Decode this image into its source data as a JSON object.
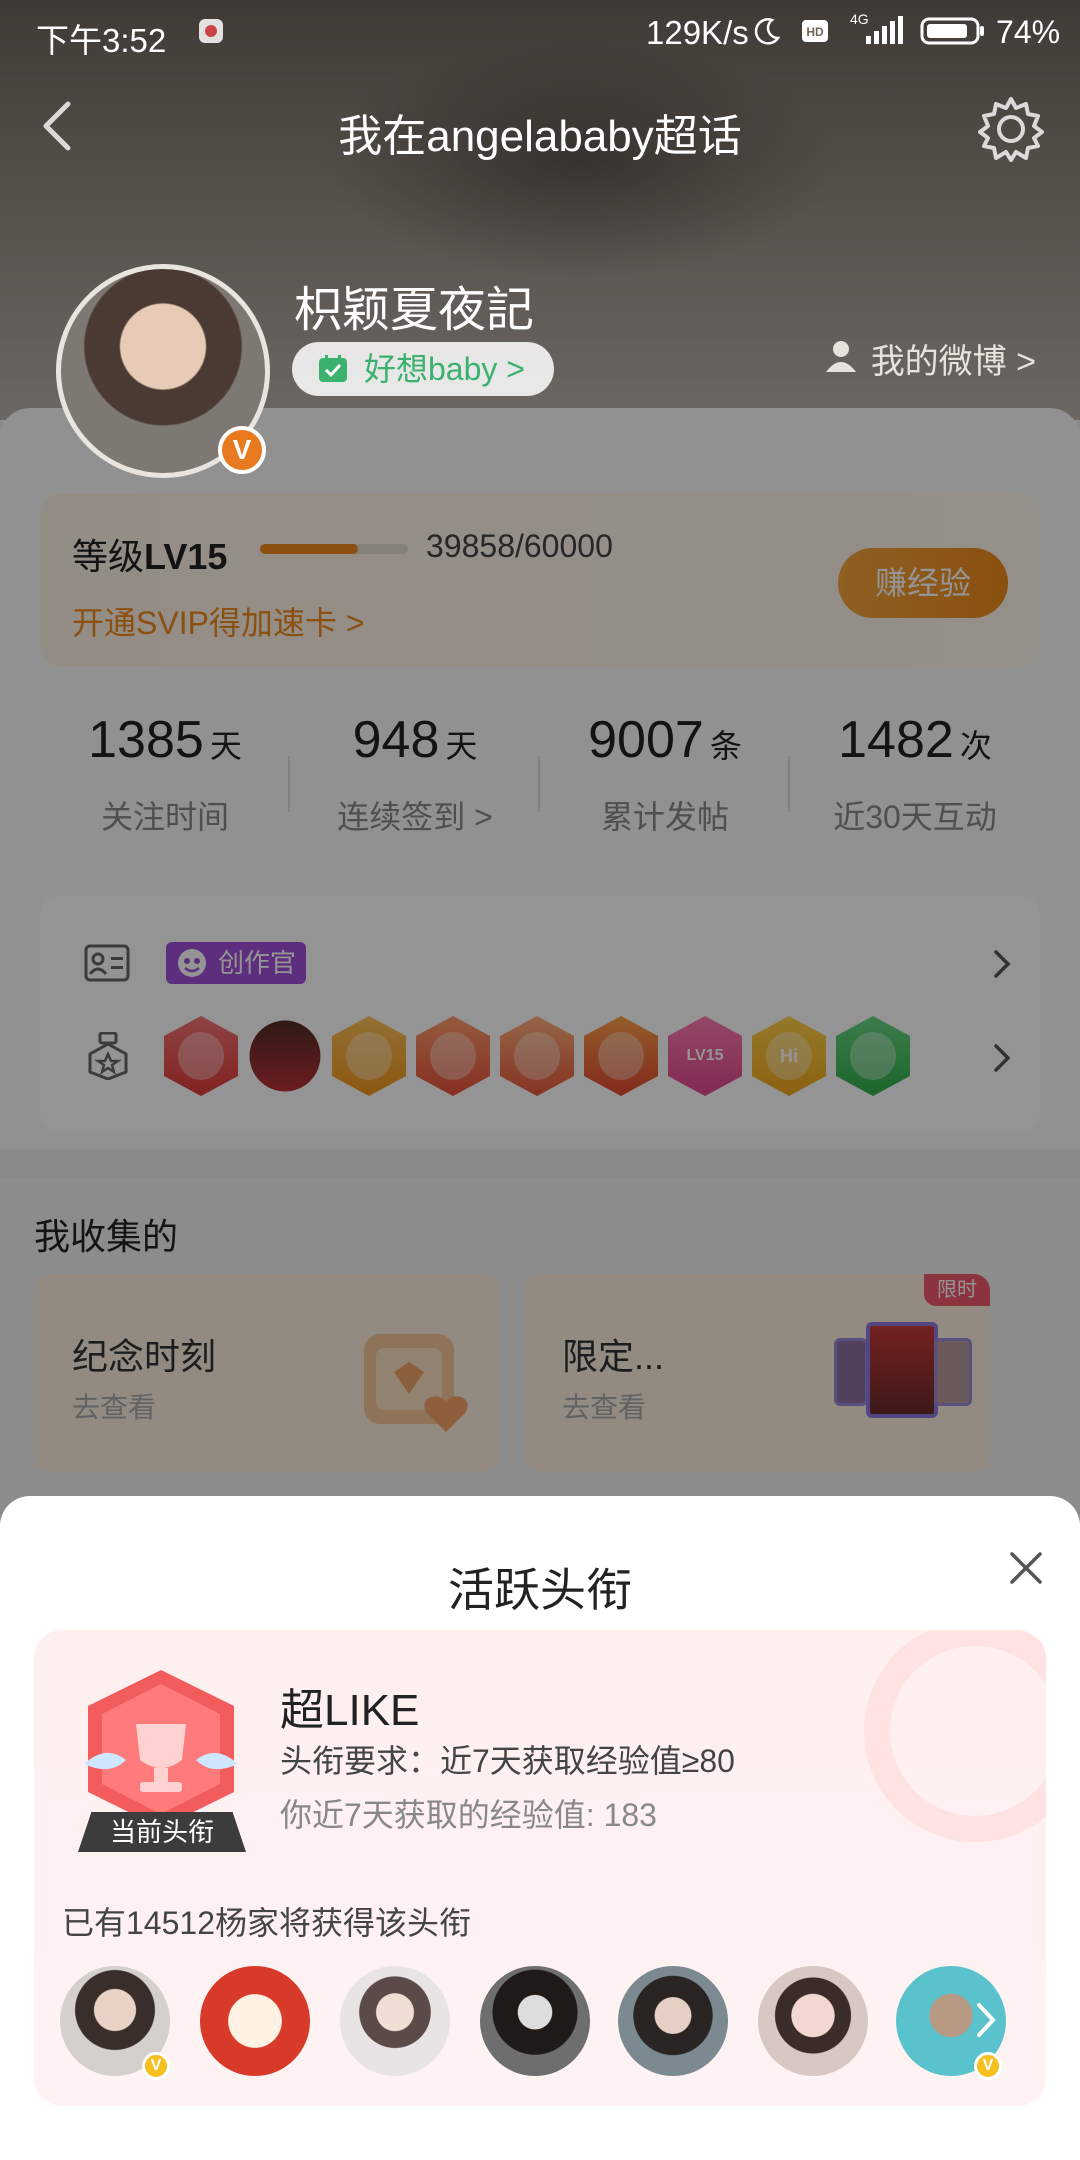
{
  "status_bar": {
    "time": "下午3:52",
    "net_rate": "129K/s",
    "network": "4G",
    "battery": "74%"
  },
  "nav": {
    "title": "我在angelababy超话"
  },
  "profile": {
    "username": "枳颖夏夜記",
    "mood": "好想baby >",
    "my_weibo": "我的微博 >"
  },
  "level": {
    "label_prefix": "等级",
    "label_level": "LV15",
    "progress_text": "39858/60000",
    "progress": 0.6643,
    "svip_link": "开通SVIP得加速卡 >",
    "earn_button": "赚经验"
  },
  "stats": [
    {
      "value": "1385",
      "unit": "天",
      "label": "关注时间"
    },
    {
      "value": "948",
      "unit": "天",
      "label": "连续签到 >"
    },
    {
      "value": "9007",
      "unit": "条",
      "label": "累计发帖"
    },
    {
      "value": "1482",
      "unit": "次",
      "label": "近30天互动"
    }
  ],
  "badges": {
    "creator_tag": "创作官",
    "medal_icons": [
      "trophy-medal-icon",
      "girl-avatar-medal-icon",
      "crown-medal-icon",
      "dragon-medal-icon",
      "dragon-medal-icon",
      "dragon-medal-icon",
      "lv15-medal-icon",
      "hi-medal-icon",
      "hand-medal-icon"
    ],
    "medal_label_lv": "LV15",
    "medal_label_hi": "Hi"
  },
  "collection": {
    "title": "我收集的",
    "cards": [
      {
        "title": "纪念时刻",
        "subtitle": "去查看"
      },
      {
        "title": "限定...",
        "subtitle": "去查看",
        "tag": "限时"
      }
    ]
  },
  "sheet": {
    "title": "活跃头衔",
    "current_tag": "当前头衔",
    "title_name": "超LIKE",
    "requirement": "头衔要求：近7天获取经验值≥80",
    "my_exp": "你近7天获取的经验值: 183",
    "holders_text": "已有14512杨家将获得该头衔"
  },
  "colors": {
    "accent_orange": "#f08a1c",
    "creator_purple": "#a050d8",
    "sheet_card_bg": "#fff0f0",
    "vip_yellow": "#f7c021"
  }
}
